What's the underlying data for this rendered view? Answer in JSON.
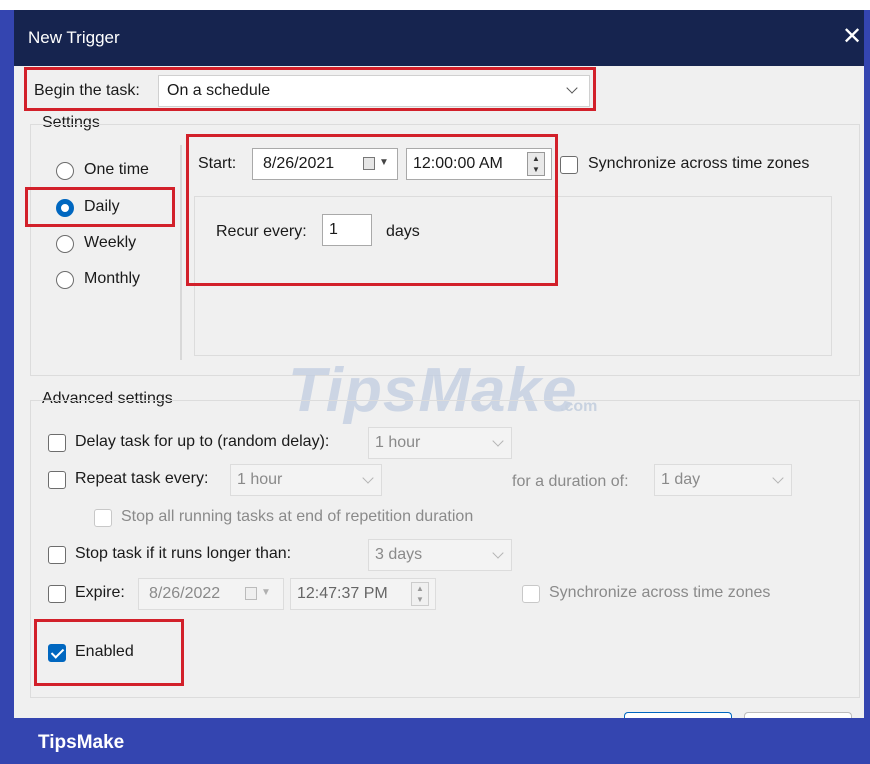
{
  "window": {
    "title": "New Trigger",
    "close_glyph": "✕"
  },
  "begin_task": {
    "label": "Begin the task:",
    "value": "On a schedule"
  },
  "settings": {
    "group_label": "Settings",
    "radios": [
      {
        "label": "One time",
        "selected": false
      },
      {
        "label": "Daily",
        "selected": true
      },
      {
        "label": "Weekly",
        "selected": false
      },
      {
        "label": "Monthly",
        "selected": false
      }
    ],
    "start_label": "Start:",
    "start_date": "8/26/2021",
    "start_time": "12:00:00 AM",
    "sync_label": "Synchronize across time zones",
    "recur_label": "Recur every:",
    "recur_value": "1",
    "recur_unit": "days"
  },
  "advanced": {
    "group_label": "Advanced settings",
    "delay_label": "Delay task for up to (random delay):",
    "delay_value": "1 hour",
    "repeat_label": "Repeat task every:",
    "repeat_value": "1 hour",
    "duration_label": "for a duration of:",
    "duration_value": "1 day",
    "stop_all_label": "Stop all running tasks at end of repetition duration",
    "stop_longer_label": "Stop task if it runs longer than:",
    "stop_longer_value": "3 days",
    "expire_label": "Expire:",
    "expire_date": "8/26/2022",
    "expire_time": "12:47:37 PM",
    "expire_sync_label": "Synchronize across time zones",
    "enabled_label": "Enabled",
    "enabled_checked": true
  },
  "watermark": {
    "text": "TipsMake",
    "suffix": ".com"
  },
  "footer": {
    "brand": "TipsMake"
  },
  "colors": {
    "accent": "#0067c0",
    "highlight": "#d2202a",
    "titlebar": "#16244f",
    "frame": "#3445b0"
  }
}
